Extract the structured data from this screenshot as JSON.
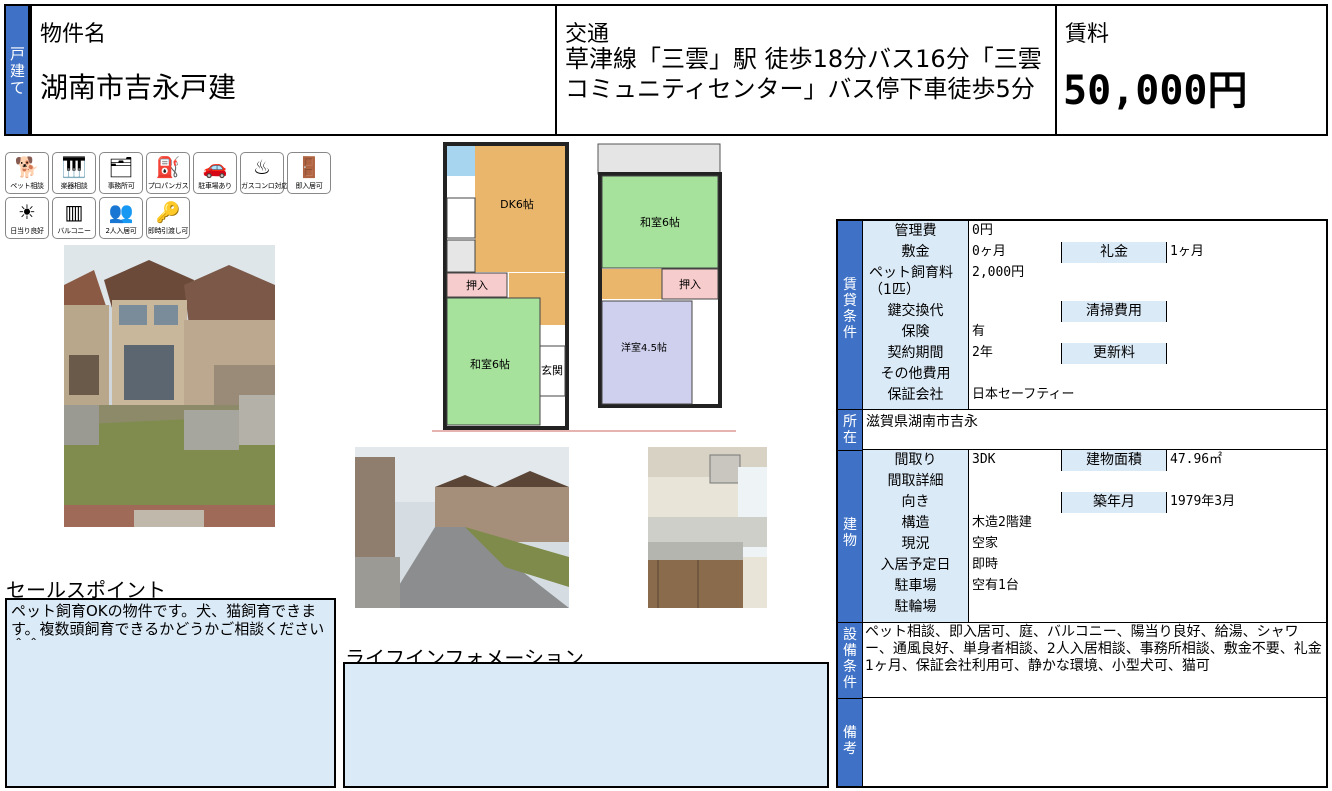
{
  "header": {
    "type_tag": "戸建て",
    "name_label": "物件名",
    "name_value": "湖南市吉永戸建",
    "access_label": "交通",
    "access_value": "草津線「三雲」駅 徒歩18分バス16分「三雲コミュニティセンター」バス停下車徒歩5分",
    "rent_label": "賃料",
    "rent_value": "50,000円"
  },
  "icons": [
    {
      "name": "pet-consult-icon",
      "label": "ペット相談"
    },
    {
      "name": "instrument-consult-icon",
      "label": "楽器相談"
    },
    {
      "name": "office-ok-icon",
      "label": "事務所可"
    },
    {
      "name": "propane-gas-icon",
      "label": "プロパンガス"
    },
    {
      "name": "parking-icon",
      "label": "駐車場あり"
    },
    {
      "name": "gas-stove-icon",
      "label": "ガスコンロ対応"
    },
    {
      "name": "immediate-move-in-icon",
      "label": "即入居可"
    },
    {
      "name": "sunny-icon",
      "label": "日当り良好"
    },
    {
      "name": "balcony-icon",
      "label": "バルコニー"
    },
    {
      "name": "two-person-icon",
      "label": "2人入居可"
    },
    {
      "name": "key-handover-icon",
      "label": "即時引渡し可"
    }
  ],
  "floorplan": {
    "rooms": [
      "DK6帖",
      "押入",
      "和室6帖",
      "玄関",
      "和室6帖",
      "押入",
      "洋室4.5帖"
    ]
  },
  "sales_point": {
    "title": "セールスポイント",
    "text": "ペット飼育OKの物件です。犬、猫飼育できます。複数頭飼育できるかどうかご相談ください＾＾"
  },
  "life_info": {
    "title": "ライフインフォメーション",
    "text": ""
  },
  "rental": {
    "tag": "賃貸条件",
    "rows": {
      "mgmt": {
        "label": "管理費",
        "value": "0円"
      },
      "deposit": {
        "label": "敷金",
        "value": "0ヶ月",
        "label2": "礼金",
        "value2": "1ヶ月"
      },
      "pet": {
        "label": "ペット飼育料（1匹）",
        "value": "2,000円"
      },
      "key": {
        "label": "鍵交換代",
        "value": "",
        "label2": "清掃費用",
        "value2": ""
      },
      "insurance": {
        "label": "保険",
        "value": "有"
      },
      "contract": {
        "label": "契約期間",
        "value": "2年",
        "label2": "更新料",
        "value2": ""
      },
      "other": {
        "label": "その他費用",
        "value": ""
      },
      "guarantor": {
        "label": "保証会社",
        "value": "日本セーフティー"
      }
    }
  },
  "location": {
    "tag": "所在",
    "value": "滋賀県湖南市吉永"
  },
  "building": {
    "tag": "建物",
    "rows": {
      "layout": {
        "label": "間取り",
        "value": "3DK",
        "label2": "建物面積",
        "value2": "47.96㎡"
      },
      "layout_detail": {
        "label": "間取詳細",
        "value": ""
      },
      "direction": {
        "label": "向き",
        "value": "",
        "label2": "築年月",
        "value2": "1979年3月"
      },
      "structure": {
        "label": "構造",
        "value": "木造2階建"
      },
      "status": {
        "label": "現況",
        "value": "空家"
      },
      "move_in": {
        "label": "入居予定日",
        "value": "即時"
      },
      "parking": {
        "label": "駐車場",
        "value": "空有1台"
      },
      "bike": {
        "label": "駐輪場",
        "value": ""
      }
    }
  },
  "facilities": {
    "tag": "設備条件",
    "text": "ペット相談、即入居可、庭、バルコニー、陽当り良好、給湯、シャワー、通風良好、単身者相談、2人入居相談、事務所相談、敷金不要、礼金1ヶ月、保証会社利用可、静かな環境、小型犬可、猫可"
  },
  "remarks": {
    "tag": "備考",
    "text": ""
  }
}
